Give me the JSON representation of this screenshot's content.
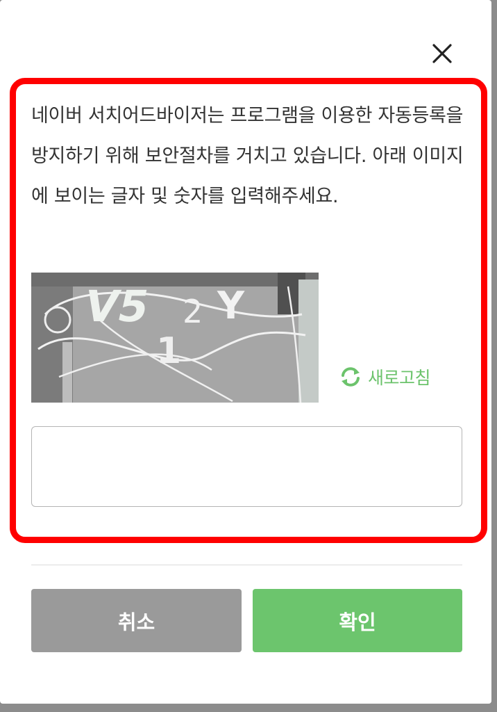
{
  "dialog": {
    "message": "네이버 서치어드바이저는 프로그램을 이용한 자동등록을 방지하기 위해 보안절차를 거치고 있습니다. 아래 이미지에 보이는 글자 및 숫자를 입력해주세요.",
    "captcha_characters": "V5 2Y 1",
    "refresh_label": "새로고침",
    "answer_value": "",
    "cancel_label": "취소",
    "confirm_label": "확인"
  },
  "icons": {
    "close": "close-icon",
    "refresh": "refresh-icon"
  },
  "colors": {
    "accent_green": "#6cc56d",
    "cancel_gray": "#9a9a9a",
    "highlight_red": "#ff0000",
    "text": "#333333"
  }
}
